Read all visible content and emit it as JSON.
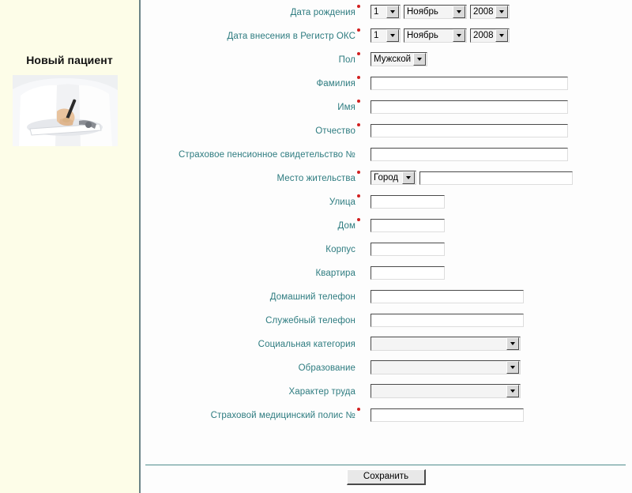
{
  "sidebar": {
    "title": "Новый пациент",
    "photo_alt": "doctor-writing-photo"
  },
  "form": {
    "rows": [
      {
        "key": "birth_date",
        "label": "Дата рождения",
        "required": true,
        "type": "date",
        "day": "1",
        "month": "Ноябрь",
        "year": "2008"
      },
      {
        "key": "registry_date",
        "label": "Дата внесения в Регистр ОКС",
        "required": true,
        "type": "date",
        "day": "1",
        "month": "Ноябрь",
        "year": "2008"
      },
      {
        "key": "gender",
        "label": "Пол",
        "required": true,
        "type": "select",
        "value": "Мужской"
      },
      {
        "key": "last_name",
        "label": "Фамилия",
        "required": true,
        "type": "text",
        "value": "",
        "width": "full"
      },
      {
        "key": "first_name",
        "label": "Имя",
        "required": true,
        "type": "text",
        "value": "",
        "width": "full"
      },
      {
        "key": "middle_name",
        "label": "Отчество",
        "required": true,
        "type": "text",
        "value": "",
        "width": "full"
      },
      {
        "key": "pension_certificate",
        "label": "Страховое пенсионное свидетельство №",
        "required": false,
        "type": "text",
        "value": "",
        "width": "full"
      },
      {
        "key": "residence",
        "label": "Место жительства",
        "required": true,
        "type": "select_plus_text",
        "value": "Город",
        "text_value": ""
      },
      {
        "key": "street",
        "label": "Улица",
        "required": true,
        "type": "text",
        "value": "",
        "width": "small"
      },
      {
        "key": "house",
        "label": "Дом",
        "required": true,
        "type": "text",
        "value": "",
        "width": "small"
      },
      {
        "key": "building",
        "label": "Корпус",
        "required": false,
        "type": "text",
        "value": "",
        "width": "small"
      },
      {
        "key": "apartment",
        "label": "Квартира",
        "required": false,
        "type": "text",
        "value": "",
        "width": "small"
      },
      {
        "key": "home_phone",
        "label": "Домашний телефон",
        "required": false,
        "type": "text",
        "value": "",
        "width": "wide"
      },
      {
        "key": "work_phone",
        "label": "Служебный телефон",
        "required": false,
        "type": "text",
        "value": "",
        "width": "wide"
      },
      {
        "key": "social_category",
        "label": "Социальная категория",
        "required": false,
        "type": "select_long",
        "value": ""
      },
      {
        "key": "education",
        "label": "Образование",
        "required": false,
        "type": "select_long",
        "value": ""
      },
      {
        "key": "labor_type",
        "label": "Характер труда",
        "required": false,
        "type": "select_long",
        "value": ""
      },
      {
        "key": "medical_policy",
        "label": "Страховой медицинский полис №",
        "required": true,
        "type": "text",
        "value": "",
        "width": "wide"
      }
    ],
    "save_label": "Сохранить"
  },
  "colors": {
    "label": "#2e7c80",
    "required_dot": "#d22020",
    "sidebar_bg": "#fdfde8",
    "divider": "#6b8387",
    "rule": "#4f8c8c"
  }
}
